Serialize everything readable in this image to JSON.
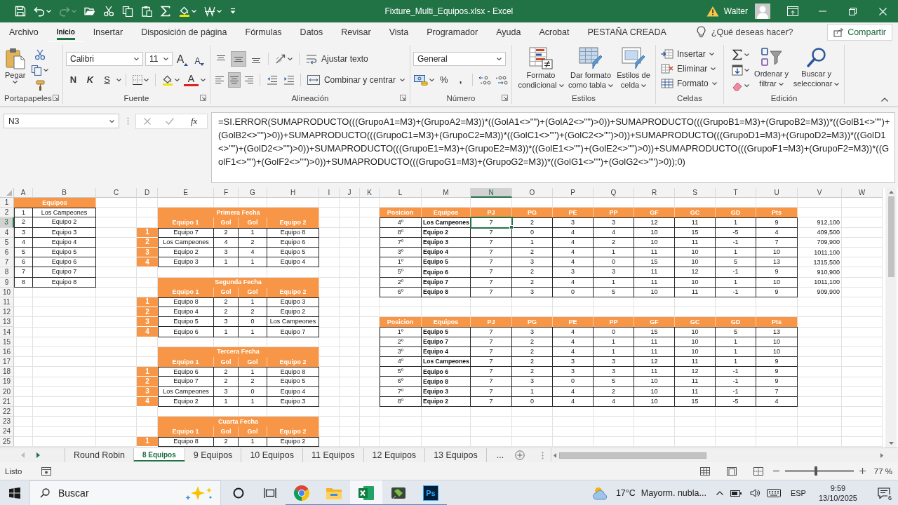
{
  "window": {
    "title": "Fixture_Multi_Equipos.xlsx - Excel",
    "user": "Walter"
  },
  "quick_access": [
    {
      "kind": "save",
      "dropdown": false,
      "disabled": false
    },
    {
      "kind": "undo",
      "dropdown": true,
      "disabled": false
    },
    {
      "kind": "redo",
      "dropdown": true,
      "disabled": true
    },
    {
      "kind": "open",
      "dropdown": false,
      "disabled": false
    },
    {
      "kind": "cut",
      "dropdown": false,
      "disabled": false
    },
    {
      "kind": "copy",
      "dropdown": false,
      "disabled": false
    },
    {
      "kind": "paste",
      "dropdown": false,
      "disabled": false
    },
    {
      "kind": "autosum",
      "dropdown": false,
      "disabled": false
    },
    {
      "kind": "fill",
      "dropdown": true,
      "disabled": false
    },
    {
      "kind": "pattern",
      "dropdown": true,
      "disabled": false
    },
    {
      "kind": "customize",
      "dropdown": false,
      "disabled": false
    }
  ],
  "ribbon_tabs": [
    {
      "label": "Archivo",
      "selected": false
    },
    {
      "label": "Inicio",
      "selected": true
    },
    {
      "label": "Insertar",
      "selected": false
    },
    {
      "label": "Disposición de página",
      "selected": false
    },
    {
      "label": "Fórmulas",
      "selected": false
    },
    {
      "label": "Datos",
      "selected": false
    },
    {
      "label": "Revisar",
      "selected": false
    },
    {
      "label": "Vista",
      "selected": false
    },
    {
      "label": "Programador",
      "selected": false
    },
    {
      "label": "Ayuda",
      "selected": false
    },
    {
      "label": "Acrobat",
      "selected": false
    },
    {
      "label": "PESTAÑA CREADA",
      "selected": false
    }
  ],
  "tell_me": {
    "placeholder": "¿Qué deseas hacer?"
  },
  "share_button": "Compartir",
  "clipboard_group": {
    "label": "Portapapeles",
    "launcher": true,
    "paste_button": "Pegar"
  },
  "font_group": {
    "label": "Fuente",
    "launcher": true,
    "font_name": "Calibri",
    "font_size": "11",
    "grow_font": "A",
    "shrink_font": "A",
    "bold_button": "N",
    "italic_button": "K",
    "underline_button": "S",
    "font_color_button": "A"
  },
  "alignment_group": {
    "label": "Alineación",
    "launcher": true,
    "vertical_align": [
      {
        "kind": "top",
        "selected": false
      },
      {
        "kind": "middle",
        "selected": true
      },
      {
        "kind": "bottom",
        "selected": false
      }
    ],
    "wrap_text_button": "Ajustar texto",
    "horizontal_align": [
      {
        "kind": "left",
        "selected": false
      },
      {
        "kind": "center",
        "selected": true
      },
      {
        "kind": "right",
        "selected": false
      }
    ],
    "merge_button": "Combinar y centrar"
  },
  "number_group": {
    "label": "Número",
    "launcher": true,
    "format": "General",
    "percent_button": "%",
    "comma_button": ","
  },
  "styles_group": {
    "label": "Estilos",
    "launcher": false,
    "buttons": [
      {
        "kind": "conditional",
        "label": "Formato condicional"
      },
      {
        "kind": "table",
        "label": "Dar formato como tabla"
      },
      {
        "kind": "cell_styles",
        "label": "Estilos de celda"
      }
    ]
  },
  "cells_group": {
    "label": "Celdas",
    "launcher": false,
    "buttons": [
      {
        "kind": "insert",
        "label": "Insertar"
      },
      {
        "kind": "delete",
        "label": "Eliminar"
      },
      {
        "kind": "format",
        "label": "Formato"
      }
    ]
  },
  "editing_group": {
    "label": "Edición",
    "launcher": false,
    "buttons": [
      {
        "kind": "sort",
        "label": "Ordenar y filtrar"
      },
      {
        "kind": "find",
        "label": "Buscar y seleccionar"
      }
    ]
  },
  "formula_bar": {
    "name_box": "N3",
    "insert_function": "fx",
    "formula": "=SI.ERROR(SUMAPRODUCTO(((GrupoA1=M3)+(GrupoA2=M3))*((GolA1<>\"\")+(GolA2<>\"\")>0))+SUMAPRODUCTO(((GrupoB1=M3)+(GrupoB2=M3))*((GolB1<>\"\")+(GolB2<>\"\")>0))+SUMAPRODUCTO(((GrupoC1=M3)+(GrupoC2=M3))*((GolC1<>\"\")+(GolC2<>\"\")>0))+SUMAPRODUCTO(((GrupoD1=M3)+(GrupoD2=M3))*((GolD1<>\"\")+(GolD2<>\"\")>0))+SUMAPRODUCTO(((GrupoE1=M3)+(GrupoE2=M3))*((GolE1<>\"\")+(GolE2<>\"\")>0))+SUMAPRODUCTO(((GrupoF1=M3)+(GrupoF2=M3))*((GolF1<>\"\")+(GolF2<>\"\")>0))+SUMAPRODUCTO(((GrupoG1=M3)+(GrupoG2=M3))*((GolG1<>\"\")+(GolG2<>\"\")>0));0)"
  },
  "sheet": {
    "columns": [
      {
        "label": "A",
        "selected": false
      },
      {
        "label": "B",
        "selected": false
      },
      {
        "label": "C",
        "selected": false
      },
      {
        "label": "D",
        "selected": false
      },
      {
        "label": "E",
        "selected": false
      },
      {
        "label": "F",
        "selected": false
      },
      {
        "label": "G",
        "selected": false
      },
      {
        "label": "H",
        "selected": false
      },
      {
        "label": "I",
        "selected": false
      },
      {
        "label": "J",
        "selected": false
      },
      {
        "label": "K",
        "selected": false
      },
      {
        "label": "L",
        "selected": false
      },
      {
        "label": "M",
        "selected": false
      },
      {
        "label": "N",
        "selected": true
      },
      {
        "label": "O",
        "selected": false
      },
      {
        "label": "P",
        "selected": false
      },
      {
        "label": "Q",
        "selected": false
      },
      {
        "label": "R",
        "selected": false
      },
      {
        "label": "S",
        "selected": false
      },
      {
        "label": "T",
        "selected": false
      },
      {
        "label": "U",
        "selected": false
      },
      {
        "label": "V",
        "selected": false
      },
      {
        "label": "W",
        "selected": false
      }
    ],
    "rows": [
      {
        "label": "1",
        "selected": false
      },
      {
        "label": "2",
        "selected": false
      },
      {
        "label": "3",
        "selected": true
      },
      {
        "label": "4",
        "selected": false
      },
      {
        "label": "5",
        "selected": false
      },
      {
        "label": "6",
        "selected": false
      },
      {
        "label": "7",
        "selected": false
      },
      {
        "label": "8",
        "selected": false
      },
      {
        "label": "9",
        "selected": false
      },
      {
        "label": "10",
        "selected": false
      },
      {
        "label": "11",
        "selected": false
      },
      {
        "label": "12",
        "selected": false
      },
      {
        "label": "13",
        "selected": false
      },
      {
        "label": "14",
        "selected": false
      },
      {
        "label": "15",
        "selected": false
      },
      {
        "label": "16",
        "selected": false
      },
      {
        "label": "17",
        "selected": false
      },
      {
        "label": "18",
        "selected": false
      },
      {
        "label": "19",
        "selected": false
      },
      {
        "label": "20",
        "selected": false
      },
      {
        "label": "21",
        "selected": false
      },
      {
        "label": "22",
        "selected": false
      },
      {
        "label": "23",
        "selected": false
      },
      {
        "label": "24",
        "selected": false
      },
      {
        "label": "25",
        "selected": false
      }
    ],
    "team_list": {
      "header": "Equipos",
      "rows": [
        {
          "number": "1",
          "team": "Los Campeones"
        },
        {
          "number": "2",
          "team": "Equipo 2"
        },
        {
          "number": "3",
          "team": "Equipo 3"
        },
        {
          "number": "4",
          "team": "Equipo 4"
        },
        {
          "number": "5",
          "team": "Equipo 5"
        },
        {
          "number": "6",
          "team": "Equipo 6"
        },
        {
          "number": "7",
          "team": "Equipo 7"
        },
        {
          "number": "8",
          "team": "Equipo 8"
        }
      ]
    },
    "fixtures": [
      {
        "title": "Primera Fecha",
        "columns": [
          "Equipo 1",
          "Gol",
          "Gol",
          "Equipo 2"
        ],
        "matches": [
          {
            "number": "1",
            "team_1": "Equipo 7",
            "goals_1": "2",
            "goals_2": "1",
            "team_2": "Equipo 8"
          },
          {
            "number": "2",
            "team_1": "Los Campeones",
            "goals_1": "4",
            "goals_2": "2",
            "team_2": "Equipo 6"
          },
          {
            "number": "3",
            "team_1": "Equipo 2",
            "goals_1": "3",
            "goals_2": "4",
            "team_2": "Equipo 5"
          },
          {
            "number": "4",
            "team_1": "Equipo 3",
            "goals_1": "1",
            "goals_2": "1",
            "team_2": "Equipo 4"
          }
        ]
      },
      {
        "title": "Segunda Fecha",
        "columns": [
          "Equipo 1",
          "Gol",
          "Gol",
          "Equipo 2"
        ],
        "matches": [
          {
            "number": "1",
            "team_1": "Equipo 8",
            "goals_1": "2",
            "goals_2": "1",
            "team_2": "Equipo 3"
          },
          {
            "number": "2",
            "team_1": "Equipo 4",
            "goals_1": "2",
            "goals_2": "2",
            "team_2": "Equipo 2"
          },
          {
            "number": "3",
            "team_1": "Equipo 5",
            "goals_1": "3",
            "goals_2": "0",
            "team_2": "Los Campeones"
          },
          {
            "number": "4",
            "team_1": "Equipo 6",
            "goals_1": "1",
            "goals_2": "1",
            "team_2": "Equipo 7"
          }
        ]
      },
      {
        "title": "Tercera Fecha",
        "columns": [
          "Equipo 1",
          "Gol",
          "Gol",
          "Equipo 2"
        ],
        "matches": [
          {
            "number": "1",
            "team_1": "Equipo 6",
            "goals_1": "2",
            "goals_2": "1",
            "team_2": "Equipo 8"
          },
          {
            "number": "2",
            "team_1": "Equipo 7",
            "goals_1": "2",
            "goals_2": "2",
            "team_2": "Equipo 5"
          },
          {
            "number": "3",
            "team_1": "Los Campeones",
            "goals_1": "3",
            "goals_2": "0",
            "team_2": "Equipo 4"
          },
          {
            "number": "4",
            "team_1": "Equipo 2",
            "goals_1": "1",
            "goals_2": "1",
            "team_2": "Equipo 3"
          }
        ]
      },
      {
        "title": "Cuarta Fecha",
        "columns": [
          "Equipo 1",
          "Gol",
          "Gol",
          "Equipo 2"
        ],
        "matches": [
          {
            "number": "1",
            "team_1": "Equipo 8",
            "goals_1": "2",
            "goals_2": "1",
            "team_2": "Equipo 2"
          }
        ]
      }
    ],
    "standings": [
      {
        "columns": [
          "Posicion",
          "Equipos",
          "PJ",
          "PG",
          "PE",
          "PP",
          "GF",
          "GC",
          "GD",
          "Pts"
        ],
        "rows": [
          [
            "4º",
            "Los Campeones",
            "7",
            "2",
            "3",
            "3",
            "12",
            "11",
            "1",
            "9"
          ],
          [
            "8º",
            "Equipo 2",
            "7",
            "0",
            "4",
            "4",
            "10",
            "15",
            "-5",
            "4"
          ],
          [
            "7º",
            "Equipo 3",
            "7",
            "1",
            "4",
            "2",
            "10",
            "11",
            "-1",
            "7"
          ],
          [
            "3º",
            "Equipo 4",
            "7",
            "2",
            "4",
            "1",
            "11",
            "10",
            "1",
            "10"
          ],
          [
            "1º",
            "Equipo 5",
            "7",
            "3",
            "4",
            "0",
            "15",
            "10",
            "5",
            "13"
          ],
          [
            "5º",
            "Equipo 6",
            "7",
            "2",
            "3",
            "3",
            "11",
            "12",
            "-1",
            "9"
          ],
          [
            "2º",
            "Equipo 7",
            "7",
            "2",
            "4",
            "1",
            "11",
            "10",
            "1",
            "10"
          ],
          [
            "6º",
            "Equipo 8",
            "7",
            "3",
            "0",
            "5",
            "10",
            "11",
            "-1",
            "9"
          ]
        ]
      },
      {
        "columns": [
          "Posicion",
          "Equipos",
          "PJ",
          "PG",
          "PE",
          "PP",
          "GF",
          "GC",
          "GD",
          "Pts"
        ],
        "rows": [
          [
            "1º",
            "Equipo 5",
            "7",
            "3",
            "4",
            "0",
            "15",
            "10",
            "5",
            "13"
          ],
          [
            "2º",
            "Equipo 7",
            "7",
            "2",
            "4",
            "1",
            "11",
            "10",
            "1",
            "10"
          ],
          [
            "3º",
            "Equipo 4",
            "7",
            "2",
            "4",
            "1",
            "11",
            "10",
            "1",
            "10"
          ],
          [
            "4º",
            "Los Campeones",
            "7",
            "2",
            "3",
            "3",
            "12",
            "11",
            "1",
            "9"
          ],
          [
            "5º",
            "Equipo 6",
            "7",
            "2",
            "3",
            "3",
            "11",
            "12",
            "-1",
            "9"
          ],
          [
            "6º",
            "Equipo 8",
            "7",
            "3",
            "0",
            "5",
            "10",
            "11",
            "-1",
            "9"
          ],
          [
            "7º",
            "Equipo 3",
            "7",
            "1",
            "4",
            "2",
            "10",
            "11",
            "-1",
            "7"
          ],
          [
            "8º",
            "Equipo 2",
            "7",
            "0",
            "4",
            "4",
            "10",
            "15",
            "-5",
            "4"
          ]
        ]
      }
    ],
    "column_v": [
      "912,100",
      "409,500",
      "709,900",
      "1011,100",
      "1315,500",
      "910,900",
      "1011,100",
      "909,900"
    ]
  },
  "sheet_tabs": {
    "tabs": [
      {
        "label": "Round Robin",
        "selected": false
      },
      {
        "label": "8 Equipos",
        "selected": true
      },
      {
        "label": "9 Equipos",
        "selected": false
      },
      {
        "label": "10 Equipos",
        "selected": false
      },
      {
        "label": "11 Equipos",
        "selected": false
      },
      {
        "label": "12 Equipos",
        "selected": false
      },
      {
        "label": "13 Equipos",
        "selected": false
      }
    ],
    "more": "..."
  },
  "status_bar": {
    "status": "Listo",
    "zoom_slider": {
      "level": 0.45
    },
    "zoom": "77 %"
  },
  "taskbar": {
    "search": {
      "placeholder": "Buscar"
    },
    "apps": [
      {
        "kind": "chrome",
        "running": true,
        "active": false
      },
      {
        "kind": "explorer",
        "running": true,
        "active": false
      },
      {
        "kind": "excel",
        "running": true,
        "active": true
      },
      {
        "kind": "chip",
        "running": true,
        "active": false
      },
      {
        "kind": "photoshop",
        "running": true,
        "active": false,
        "label": "Ps"
      }
    ],
    "weather": {
      "temperature": "17°C",
      "condition": "Mayorm. nubla..."
    },
    "language": "ESP",
    "time": "9:59",
    "date": "13/10/2025",
    "notifications": "6"
  }
}
